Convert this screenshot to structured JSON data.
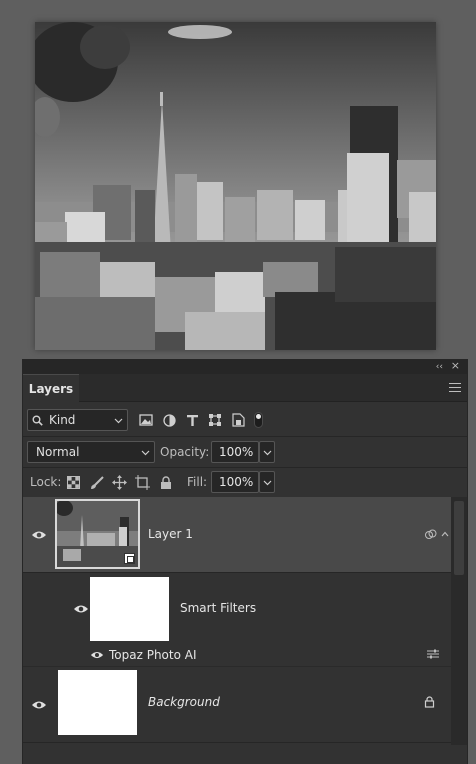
{
  "panel": {
    "collapse_label": "‹‹",
    "close_label": "×",
    "tab": "Layers",
    "menu_icon": "panel-menu-icon"
  },
  "filter": {
    "kind_label": "Kind",
    "icons": [
      "search-icon",
      "pixel-filter-icon",
      "adjustment-filter-icon",
      "type-filter-icon",
      "shape-filter-icon",
      "smart-object-filter-icon",
      "filter-toggle-icon"
    ]
  },
  "blend": {
    "mode": "Normal",
    "opacity_label": "Opacity:",
    "opacity_value": "100%"
  },
  "lock": {
    "label": "Lock:",
    "fill_label": "Fill:",
    "fill_value": "100%",
    "icons": [
      "lock-transparent-icon",
      "lock-image-icon",
      "lock-position-icon",
      "lock-artboard-icon",
      "lock-all-icon"
    ]
  },
  "layers": [
    {
      "name": "Layer 1",
      "selected": true
    },
    {
      "name": "Smart Filters"
    },
    {
      "name": "Topaz Photo AI"
    },
    {
      "name": "Background",
      "locked": true
    }
  ],
  "colors": {
    "background": "#5f5f5f",
    "panel": "#323232",
    "selected_row": "#494949"
  }
}
